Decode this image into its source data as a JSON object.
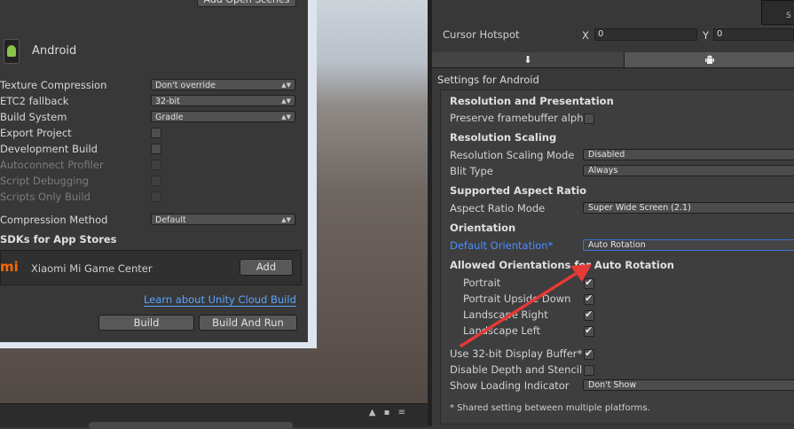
{
  "build": {
    "add_open_scenes": "Add Open Scenes",
    "platform_title": "Android",
    "rows": [
      {
        "label": "Texture Compression",
        "value": "Don't override"
      },
      {
        "label": "ETC2 fallback",
        "value": "32-bit"
      },
      {
        "label": "Build System",
        "value": "Gradle"
      },
      {
        "label": "Export Project"
      },
      {
        "label": "Development Build"
      },
      {
        "label": "Autoconnect Profiler"
      },
      {
        "label": "Script Debugging"
      },
      {
        "label": "Scripts Only Build"
      },
      {
        "label": "Compression Method",
        "value": "Default"
      }
    ],
    "sdk_heading": "SDKs for App Stores",
    "sdk_logo": "mi",
    "sdk_name": "Xiaomi Mi Game Center",
    "sdk_add": "Add",
    "cloud_link": "Learn about Unity Cloud Build",
    "build_btn": "Build",
    "build_run_btn": "Build And Run"
  },
  "inspector": {
    "cursor_hotspot": "Cursor Hotspot",
    "x_label": "X",
    "x_value": "0",
    "y_label": "Y",
    "y_value": "0",
    "top_btn": "S",
    "settings_for": "Settings for Android",
    "sections": {
      "resolution": "Resolution and Presentation",
      "scaling": "Resolution Scaling",
      "aspect": "Supported Aspect Ratio",
      "orientation": "Orientation",
      "allowed": "Allowed Orientations for Auto Rotation"
    },
    "preserve_fb": "Preserve framebuffer alph",
    "scaling_mode_label": "Resolution Scaling Mode",
    "scaling_mode_value": "Disabled",
    "blit_label": "Blit Type",
    "blit_value": "Always",
    "aspect_label": "Aspect Ratio Mode",
    "aspect_value": "Super Wide Screen (2.1)",
    "orientation_label": "Default Orientation*",
    "orientation_value": "Auto Rotation",
    "orientations": [
      "Portrait",
      "Portrait Upside Down",
      "Landscape Right",
      "Landscape Left"
    ],
    "display_buffer": "Use 32-bit Display Buffer*",
    "disable_depth": "Disable Depth and Stencil",
    "loading_label": "Show Loading Indicator",
    "loading_value": "Don't Show",
    "note": "* Shared setting between multiple platforms."
  },
  "colors": {
    "annotation_arrow": "#e53935",
    "link": "#5aa7ff",
    "focus_label": "#4d8dff"
  }
}
